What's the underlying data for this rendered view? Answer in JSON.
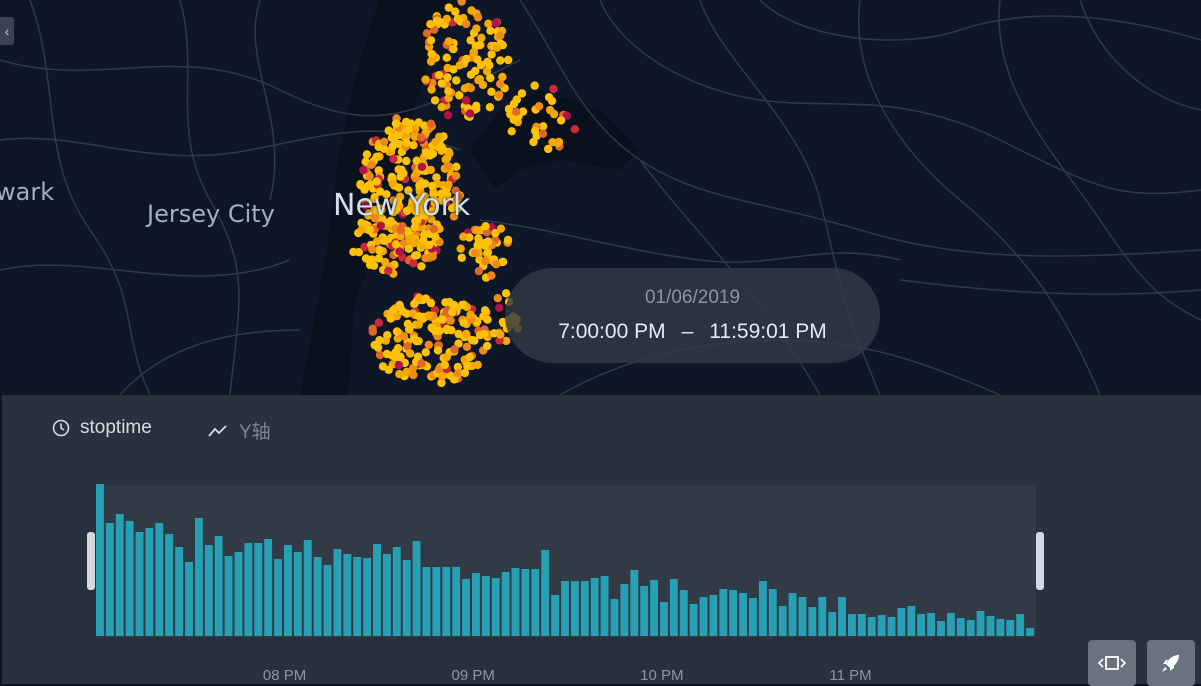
{
  "map": {
    "labels": {
      "newark": "wark",
      "jersey_city": "Jersey City",
      "new_york": "New York"
    },
    "colors": {
      "background": "#0e1727",
      "roads": "#2c3a4e",
      "water": "#0a111d",
      "points": [
        "#ffc107",
        "#f5a800",
        "#ee8a1c",
        "#e0662a",
        "#c9293a",
        "#b0124a"
      ]
    },
    "side_toggle_icon": "chevron-left-icon",
    "side_toggle_glyph": "‹"
  },
  "time_display": {
    "date": "01/06/2019",
    "start": "7:00:00 PM",
    "separator": "–",
    "end": "11:59:01 PM"
  },
  "panel": {
    "time_field": {
      "icon": "clock-icon",
      "label": "stoptime"
    },
    "y_field": {
      "icon": "line-chart-icon",
      "label": "Y轴"
    },
    "bar_color": "#26a0b4",
    "window_button_icon": "window-icon",
    "speed_button_icon": "rocket-icon"
  },
  "chart_data": {
    "type": "bar",
    "title": "",
    "xlabel": "",
    "ylabel": "",
    "x_tick_labels": [
      "08 PM",
      "09 PM",
      "10 PM",
      "11 PM"
    ],
    "x_tick_positions_hours": [
      20,
      21,
      22,
      23
    ],
    "x_range_hours": [
      19.0,
      23.9836
    ],
    "ylim": [
      0,
      152
    ],
    "values": [
      152,
      113,
      122,
      115,
      104,
      108,
      113,
      102,
      89,
      74,
      118,
      91,
      100,
      80,
      84,
      93,
      93,
      97,
      77,
      91,
      84,
      96,
      79,
      71,
      87,
      82,
      79,
      78,
      92,
      82,
      89,
      76,
      95,
      69,
      69,
      69,
      69,
      57,
      63,
      60,
      58,
      64,
      68,
      67,
      67,
      86,
      41,
      55,
      55,
      55,
      58,
      60,
      37,
      52,
      66,
      50,
      56,
      34,
      57,
      46,
      32,
      39,
      41,
      47,
      46,
      43,
      38,
      55,
      47,
      30,
      43,
      39,
      29,
      39,
      24,
      39,
      22,
      22,
      19,
      21,
      19,
      28,
      30,
      22,
      23,
      15,
      23,
      18,
      16,
      25,
      20,
      17,
      16,
      22,
      8
    ]
  }
}
